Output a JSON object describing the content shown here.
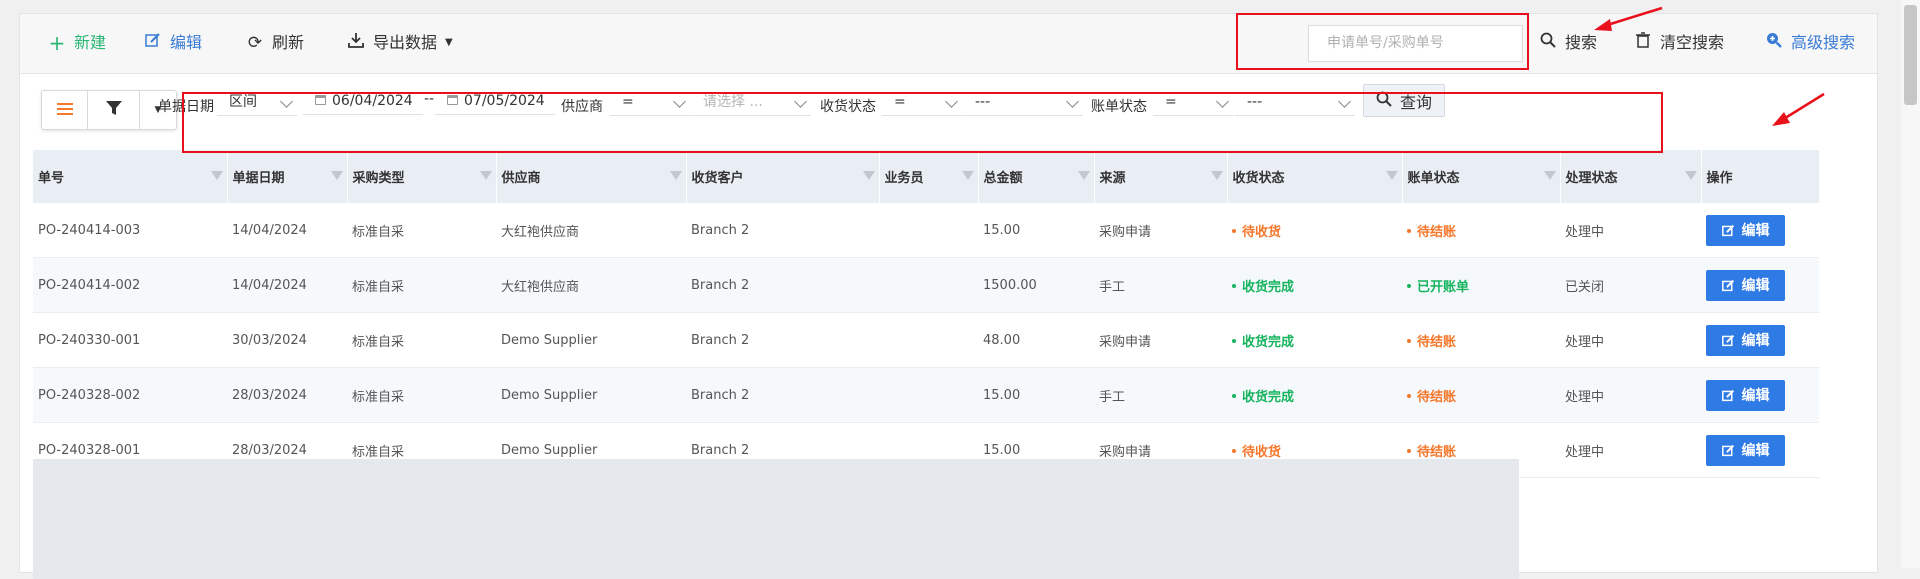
{
  "toolbar": {
    "new_label": "新建",
    "edit_label": "编辑",
    "refresh_label": "刷新",
    "export_label": "导出数据",
    "search_placeholder": "申请单号/采购单号",
    "search_label": "搜索",
    "clear_label": "清空搜索",
    "advanced_label": "高级搜索"
  },
  "filters": {
    "date_label": "单据日期",
    "date_mode": "区间",
    "date_from": "06/04/2024",
    "date_sep": "--",
    "date_to": "07/05/2024",
    "supplier_label": "供应商",
    "supplier_op": "=",
    "supplier_placeholder": "请选择 ...",
    "receive_label": "收货状态",
    "receive_op": "=",
    "receive_value": "---",
    "bill_label": "账单状态",
    "bill_op": "=",
    "bill_value": "---",
    "query_label": "查询"
  },
  "table": {
    "columns": [
      "单号",
      "单据日期",
      "采购类型",
      "供应商",
      "收货客户",
      "业务员",
      "总金额",
      "来源",
      "收货状态",
      "账单状态",
      "处理状态",
      "操作"
    ],
    "edit_label": "编辑",
    "rows": [
      {
        "no": "PO-240414-003",
        "date": "14/04/2024",
        "type": "标准自采",
        "supplier": "大红袍供应商",
        "customer": "Branch 2",
        "salesman": "",
        "amount": "15.00",
        "source": "采购申请",
        "receive": "待收货",
        "bill": "待结账",
        "process": "处理中"
      },
      {
        "no": "PO-240414-002",
        "date": "14/04/2024",
        "type": "标准自采",
        "supplier": "大红袍供应商",
        "customer": "Branch 2",
        "salesman": "",
        "amount": "1500.00",
        "source": "手工",
        "receive": "收货完成",
        "bill": "已开账单",
        "process": "已关闭"
      },
      {
        "no": "PO-240330-001",
        "date": "30/03/2024",
        "type": "标准自采",
        "supplier": "Demo Supplier",
        "customer": "Branch 2",
        "salesman": "",
        "amount": "48.00",
        "source": "采购申请",
        "receive": "收货完成",
        "bill": "待结账",
        "process": "处理中"
      },
      {
        "no": "PO-240328-002",
        "date": "28/03/2024",
        "type": "标准自采",
        "supplier": "Demo Supplier",
        "customer": "Branch 2",
        "salesman": "",
        "amount": "15.00",
        "source": "手工",
        "receive": "收货完成",
        "bill": "待结账",
        "process": "处理中"
      },
      {
        "no": "PO-240328-001",
        "date": "28/03/2024",
        "type": "标准自采",
        "supplier": "Demo Supplier",
        "customer": "Branch 2",
        "salesman": "",
        "amount": "15.00",
        "source": "采购申请",
        "receive": "待收货",
        "bill": "待结账",
        "process": "处理中"
      }
    ]
  },
  "colors": {
    "accent_blue": "#2f7be6",
    "status_pending": "#f5782c",
    "status_done": "#16b45e",
    "new_green": "#2bb673",
    "annotation_red": "#e8101a"
  }
}
